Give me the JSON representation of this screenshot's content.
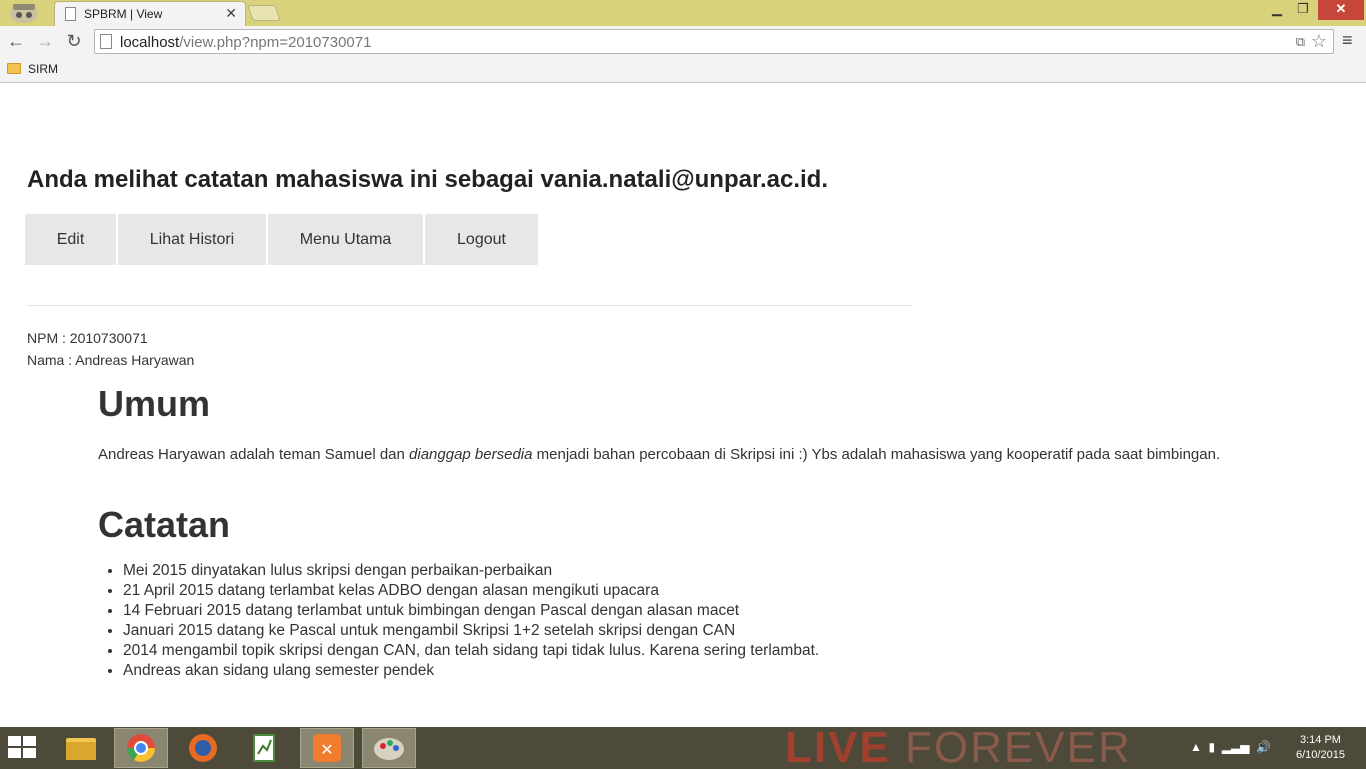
{
  "browser": {
    "tab_title": "SPBRM | View",
    "tab_close": "✕",
    "url_host": "localhost",
    "url_path": "/view.php?npm=2010730071",
    "bookmark": "SIRM",
    "icons": [
      "incognito-icon",
      "page-icon",
      "back-icon",
      "forward-icon",
      "reload-icon",
      "translate-icon",
      "star-icon",
      "menu-icon",
      "folder-icon"
    ]
  },
  "page": {
    "heading": "Anda melihat catatan mahasiswa ini sebagai vania.natali@unpar.ac.id.",
    "buttons": [
      "Edit",
      "Lihat Histori",
      "Menu Utama",
      "Logout"
    ],
    "npm_line": "NPM : 2010730071",
    "nama_line": "Nama : Andreas Haryawan",
    "umum_title": "Umum",
    "umum_text_a": "Andreas Haryawan adalah teman Samuel dan ",
    "umum_text_em": "dianggap bersedia",
    "umum_text_b": " menjadi bahan percobaan di Skripsi ini :) Ybs adalah mahasiswa yang kooperatif pada saat bimbingan.",
    "catatan_title": "Catatan",
    "notes": [
      "Mei 2015 dinyatakan lulus skripsi dengan perbaikan-perbaikan",
      "21 April 2015 datang terlambat kelas ADBO dengan alasan mengikuti upacara",
      "14 Februari 2015 datang terlambat untuk bimbingan dengan Pascal dengan alasan macet",
      "Januari 2015 datang ke Pascal untuk mengambil Skripsi 1+2 setelah skripsi dengan CAN",
      "2014 mengambil topik skripsi dengan CAN, dan telah sidang tapi tidak lulus. Karena sering terlambat.",
      "Andreas akan sidang ulang semester pendek"
    ]
  },
  "taskbar": {
    "time": "3:14 PM",
    "date": "6/10/2015",
    "wallpaper_a": "LIVE",
    "wallpaper_b": "FOREVER",
    "apps": [
      "start-icon",
      "file-explorer-icon",
      "chrome-icon",
      "firefox-icon",
      "notepad-icon",
      "xampp-icon",
      "paint-icon"
    ]
  }
}
